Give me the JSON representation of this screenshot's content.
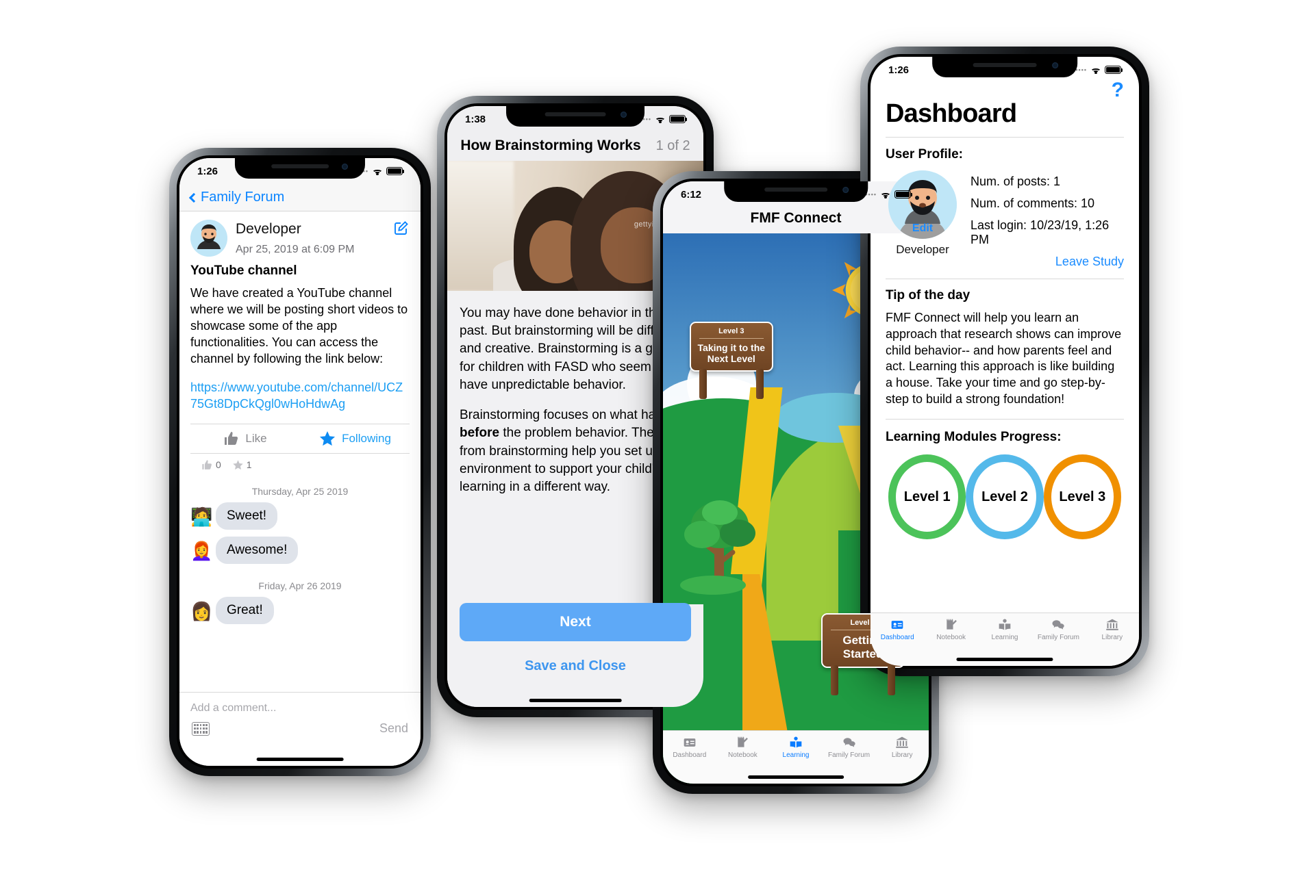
{
  "phones": {
    "forum": {
      "status_time": "1:26",
      "back_label": "Family Forum",
      "post": {
        "author": "Developer",
        "date": "Apr 25, 2019 at 6:09 PM",
        "title": "YouTube channel",
        "body": "We have created a YouTube channel where we will be posting short videos to showcase some of the app functionalities. You can access the channel by following the link below:",
        "link": "https://www.youtube.com/channel/UCZ75Gt8DpCkQgl0wHoHdwAg",
        "like_label": "Like",
        "following_label": "Following",
        "like_count": "0",
        "follow_count": "1",
        "compose_icon": "compose-icon",
        "like_icon": "thumbs-up-icon",
        "star_icon": "star-icon"
      },
      "comment_groups": [
        {
          "day": "Thursday, Apr 25 2019",
          "comments": [
            {
              "avatar": "🧑‍💻",
              "text": "Sweet!"
            },
            {
              "avatar": "👩‍🦰",
              "text": "Awesome!"
            }
          ]
        },
        {
          "day": "Friday, Apr 26 2019",
          "comments": [
            {
              "avatar": "👩",
              "text": "Great!"
            }
          ]
        }
      ],
      "composer": {
        "placeholder": "Add a comment...",
        "send_label": "Send",
        "keyboard_icon": "keyboard-icon"
      }
    },
    "brainstorm": {
      "status_time": "1:38",
      "title": "How Brainstorming Works",
      "page_counter": "1 of 2",
      "hero_watermark": "gettyimages",
      "paragraph_1": "You may have done behavior in the past. But brainstorming will be different and creative. Brainstorming is a great fit for children with FASD who seem to have unpredictable behavior.",
      "paragraph_2_pre": "Brainstorming focuses on what happens ",
      "paragraph_2_bold": "before",
      "paragraph_2_post": " the problem behavior. The ideas from brainstorming help you set up the environment to support your child's learning in a different way.",
      "next_label": "Next",
      "save_close_label": "Save and Close"
    },
    "learning": {
      "status_time": "6:12",
      "title": "FMF Connect",
      "signs": [
        {
          "level": "Level 3",
          "name": "Taking it to the\nNext Level"
        },
        {
          "level": "Level 1",
          "name": "Getting\nStarted"
        }
      ],
      "tabs": [
        {
          "label": "Dashboard",
          "icon": "id-card-icon",
          "active": false
        },
        {
          "label": "Notebook",
          "icon": "notebook-pencil-icon",
          "active": false
        },
        {
          "label": "Learning",
          "icon": "open-book-icon",
          "active": true
        },
        {
          "label": "Family Forum",
          "icon": "chat-bubbles-icon",
          "active": false
        },
        {
          "label": "Library",
          "icon": "bank-columns-icon",
          "active": false
        }
      ]
    },
    "dashboard": {
      "status_time": "1:26",
      "help_icon": "question-mark-help-icon",
      "help_label": "?",
      "title": "Dashboard",
      "user_profile_label": "User Profile:",
      "avatar_edit_label": "Edit",
      "profile_name": "Developer",
      "stats": [
        "Num. of posts: 1",
        "Num. of comments: 10",
        "Last login: 10/23/19, 1:26 PM"
      ],
      "leave_study_label": "Leave Study",
      "tip_title": "Tip of the day",
      "tip_body": "FMF Connect will help you learn an approach that research shows can improve child behavior-- and how parents feel and act. Learning this approach is like building a house. Take your time and go step-by-step to build a strong foundation!",
      "progress_label": "Learning Modules Progress:",
      "levels": [
        {
          "label": "Level 1",
          "color": "#4cc35a"
        },
        {
          "label": "Level 2",
          "color": "#54b9ea"
        },
        {
          "label": "Level 3",
          "color": "#f09000"
        }
      ],
      "tabs": [
        {
          "label": "Dashboard",
          "icon": "id-card-icon",
          "active": true
        },
        {
          "label": "Notebook",
          "icon": "notebook-pencil-icon",
          "active": false
        },
        {
          "label": "Learning",
          "icon": "open-book-icon",
          "active": false
        },
        {
          "label": "Family Forum",
          "icon": "chat-bubbles-icon",
          "active": false
        },
        {
          "label": "Library",
          "icon": "bank-columns-icon",
          "active": false
        }
      ]
    }
  }
}
